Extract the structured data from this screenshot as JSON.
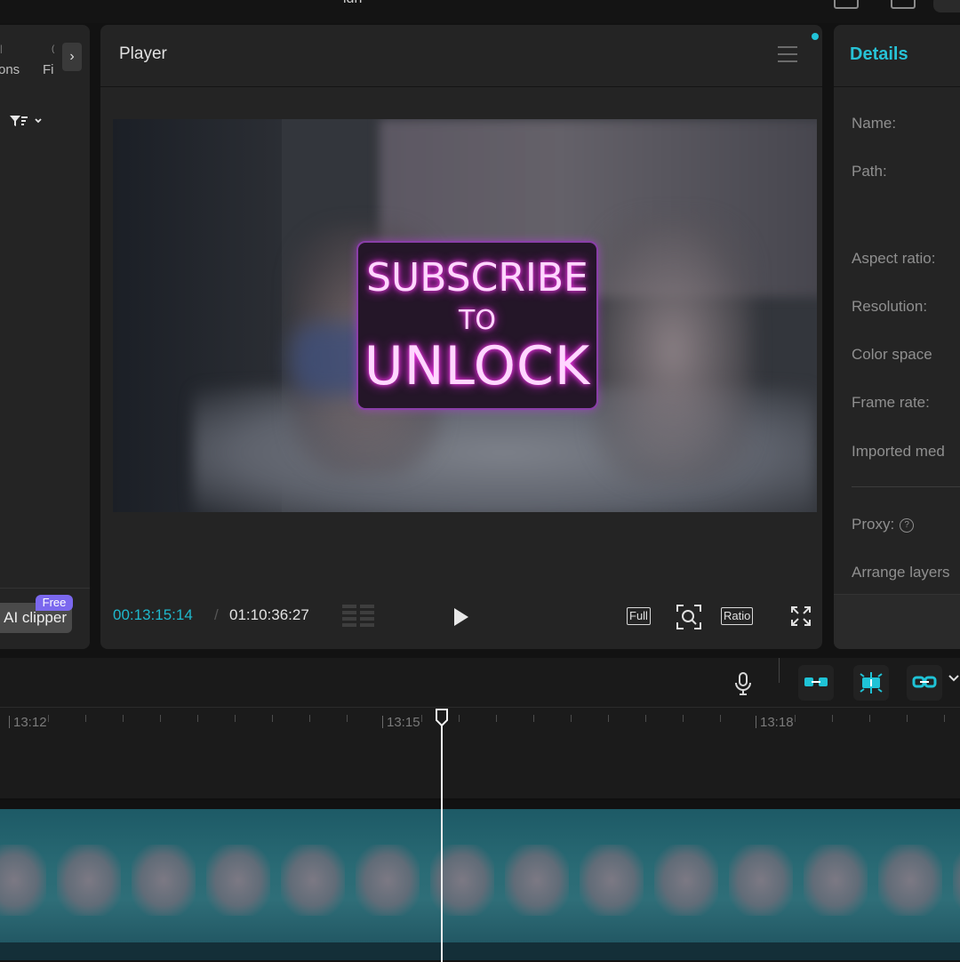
{
  "topbar": {
    "title": "ldh"
  },
  "left_panel": {
    "tab_1": "ons",
    "tab_2": "Fi",
    "expand_icon": "chevron-right-icon",
    "filter_icon": "filter-icon",
    "ai_clipper_label": "AI clipper",
    "free_badge": "Free"
  },
  "player": {
    "title": "Player",
    "menu_icon": "hamburger-menu-icon",
    "overlay": {
      "line1": "SUBSCRIBE",
      "line2": "TO",
      "line3": "UNLOCK"
    },
    "current_time": "00:13:15:14",
    "separator": "/",
    "total_time": "01:10:36:27",
    "full_label": "Full",
    "ratio_label": "Ratio",
    "accent_color": "#1fb8cc"
  },
  "details": {
    "title": "Details",
    "labels": {
      "name": "Name:",
      "path": "Path:",
      "aspect_ratio": "Aspect ratio:",
      "resolution": "Resolution:",
      "color_space": "Color space",
      "frame_rate": "Frame rate:",
      "imported_media": "Imported med",
      "proxy": "Proxy:",
      "arrange_layers": "Arrange layers"
    },
    "accent_color": "#27c2d6"
  },
  "timeline": {
    "ruler_labels": [
      "13:12",
      "13:15",
      "13:18"
    ]
  }
}
